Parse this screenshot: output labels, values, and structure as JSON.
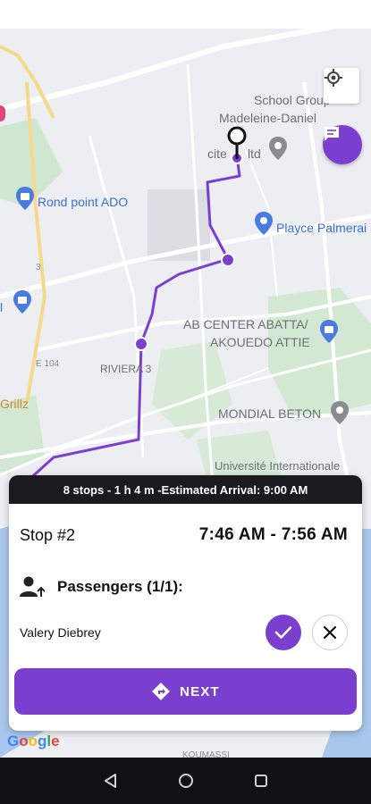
{
  "map": {
    "labels": {
      "school": "School Group",
      "madeleine": "Madeleine-Daniel",
      "cite": "cite",
      "ltd": "ltd",
      "rond_point": "Rond point ADO",
      "playce": "Playce Palmerai",
      "ab_center_1": "AB CENTER ABATTA/",
      "ab_center_2": "AKOUEDO ATTIE",
      "riviera": "RIVIERA 3",
      "grillz": "Grillz",
      "mondial": "MONDIAL BETON",
      "universite": "Université Internationale",
      "e104": "E 104",
      "koumassi": "KOUMASSI",
      "edge_l": "l",
      "road_3": "3"
    },
    "icons": {
      "my_location": "my-location-icon",
      "chat": "chat-icon",
      "destination": "destination-pin-icon"
    },
    "google_logo": "Google",
    "route_color": "#7b3fd0"
  },
  "trip": {
    "summary": "8 stops - 1 h 4 m -Estimated Arrival: 9:00 AM",
    "stop_label": "Stop #2",
    "time_window": "7:46 AM - 7:56 AM",
    "passengers_title": "Passengers (1/1):",
    "passenger_name": "Valery Diebrey",
    "next_label": "NEXT"
  },
  "colors": {
    "accent": "#7b3fd0",
    "header_bg": "#1b1b1f"
  },
  "navbar": {
    "icons": [
      "back-icon",
      "home-icon",
      "recents-icon"
    ]
  }
}
